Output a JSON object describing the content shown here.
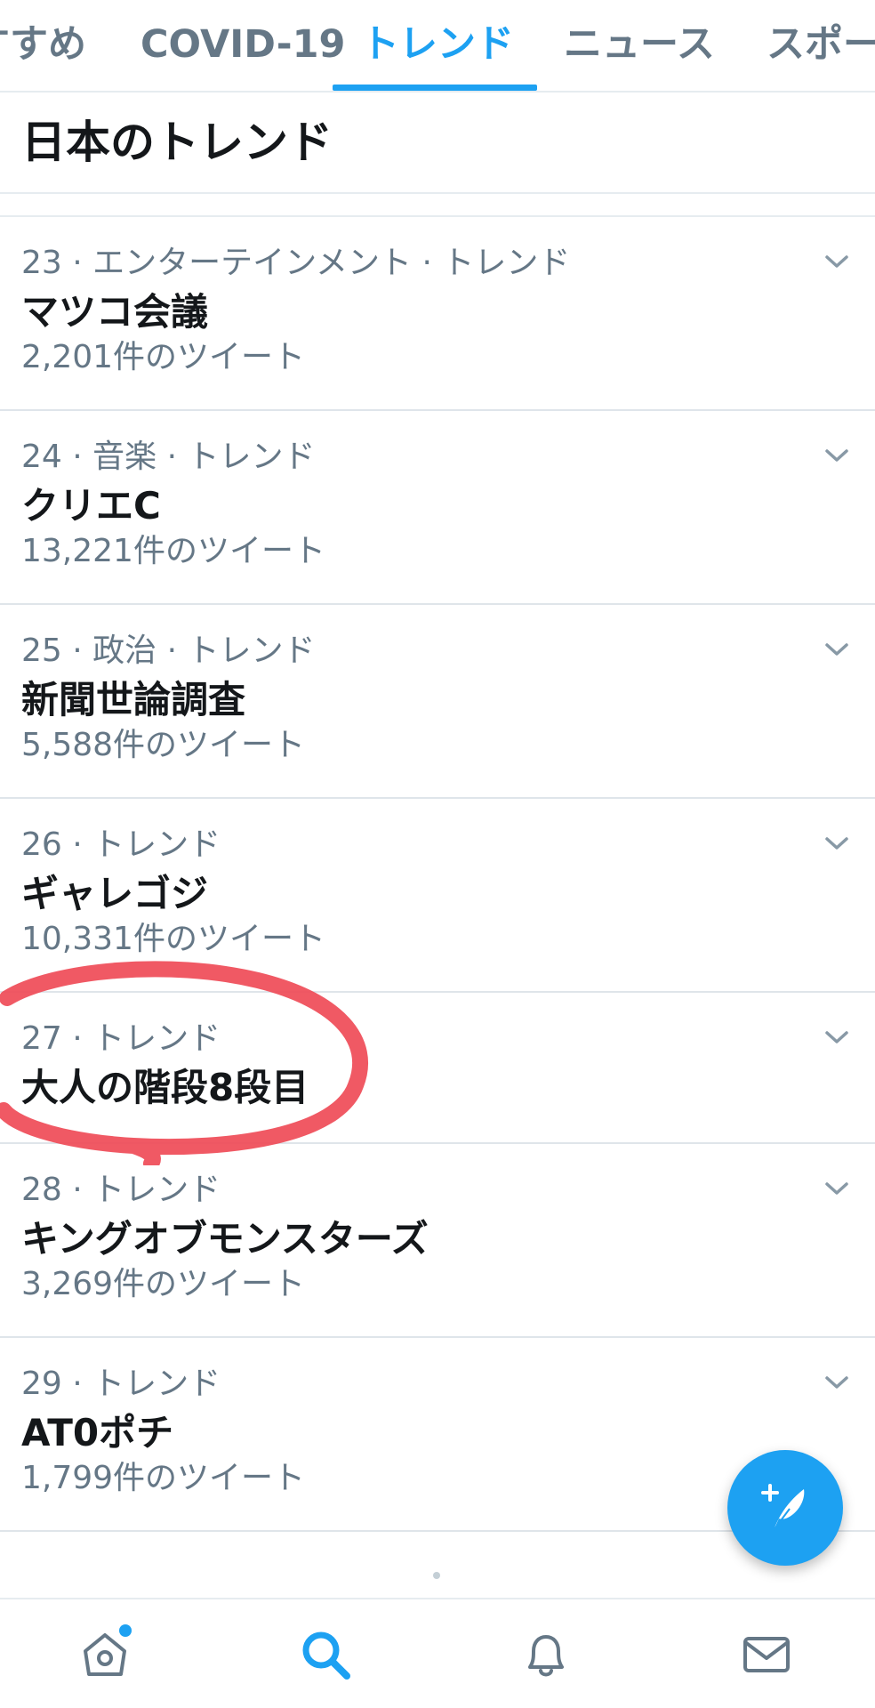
{
  "tabs": [
    {
      "label": "すすめ",
      "active": false
    },
    {
      "label": "COVID-19",
      "active": false
    },
    {
      "label": "トレンド",
      "active": true
    },
    {
      "label": "ニュース",
      "active": false
    },
    {
      "label": "スポーツ",
      "active": false
    }
  ],
  "section": {
    "title": "日本のトレンド"
  },
  "trends": [
    {
      "meta": "23 · エンターテインメント · トレンド",
      "name": "マツコ会議",
      "count": "2,201件のツイート"
    },
    {
      "meta": "24 · 音楽 · トレンド",
      "name": "クリエC",
      "count": "13,221件のツイート"
    },
    {
      "meta": "25 · 政治 · トレンド",
      "name": "新聞世論調査",
      "count": "5,588件のツイート"
    },
    {
      "meta": "26 · トレンド",
      "name": "ギャレゴジ",
      "count": "10,331件のツイート"
    },
    {
      "meta": "27 · トレンド",
      "name": "大人の階段8段目",
      "count": ""
    },
    {
      "meta": "28 · トレンド",
      "name": "キングオブモンスターズ",
      "count": "3,269件のツイート"
    },
    {
      "meta": "29 · トレンド",
      "name": "AT0ポチ",
      "count": "1,799件のツイート"
    }
  ],
  "icons": {
    "chevron": "chevron-down-icon",
    "fab": "compose-tweet-icon",
    "nav_home": "home-icon",
    "nav_search": "search-icon",
    "nav_notifications": "bell-icon",
    "nav_messages": "mail-icon"
  },
  "colors": {
    "accent": "#1da1f2",
    "secondary_text": "#657786",
    "annotation": "#ef4b57"
  }
}
